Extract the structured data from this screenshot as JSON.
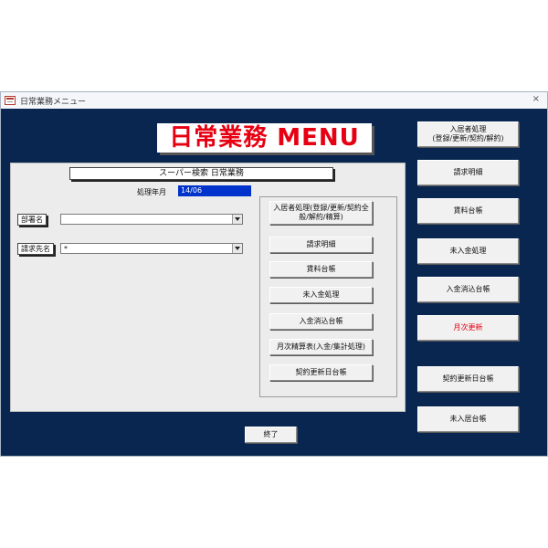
{
  "window": {
    "title": "日常業務メニュー",
    "close_label": "×"
  },
  "menu_title": "日常業務 MENU",
  "panel": {
    "header": "スーパー検索 日常業務",
    "period_label": "処理年月",
    "period_value": "14/06",
    "fields": [
      {
        "label": "部署名",
        "value": ""
      },
      {
        "label": "請求先名",
        "value": "*"
      }
    ]
  },
  "middle_buttons": [
    "入居者処理(登録/更新/契約全般/解約/精算)",
    "請求明細",
    "賃料台帳",
    "未入金処理",
    "入金消込台帳",
    "月次精算表(入金/集計処理)",
    "契約更新日台帳"
  ],
  "right_buttons": [
    {
      "label": "入居者処理\n(登録/更新/契約/解約)",
      "color": "#111111"
    },
    {
      "label": "請求明細",
      "color": "#111111"
    },
    {
      "label": "賃料台帳",
      "color": "#111111"
    },
    {
      "label": "未入金処理",
      "color": "#111111"
    },
    {
      "label": "入金消込台帳",
      "color": "#111111"
    },
    {
      "label": "月次更新",
      "color": "#e60012"
    },
    {
      "label": "契約更新日台帳",
      "color": "#111111"
    },
    {
      "label": "未入居台帳",
      "color": "#111111"
    }
  ],
  "exit_button": "終了",
  "colors": {
    "background": "#08264f",
    "title_red": "#e60012",
    "period_blue": "#0033cc"
  }
}
